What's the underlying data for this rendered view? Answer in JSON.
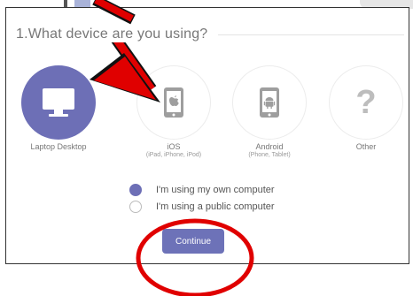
{
  "left_fragment": "e",
  "question": {
    "text": "1.What device are you using?"
  },
  "devices": [
    {
      "label": "Laptop Desktop",
      "sublabel": "",
      "icon": "monitor-icon",
      "selected": true
    },
    {
      "label": "iOS",
      "sublabel": "(iPad, iPhone, iPod)",
      "icon": "apple-phone-icon",
      "selected": false
    },
    {
      "label": "Android",
      "sublabel": "(Phone, Tablet)",
      "icon": "android-phone-icon",
      "selected": false
    },
    {
      "label": "Other",
      "sublabel": "",
      "icon": "question-mark-icon",
      "selected": false
    }
  ],
  "other_icon_glyph": "?",
  "computer_options": [
    {
      "label": "I'm using my own computer",
      "checked": true
    },
    {
      "label": "I'm using a public computer",
      "checked": false
    }
  ],
  "continue_button": {
    "label": "Continue"
  },
  "colors": {
    "accent": "#6d6fb6",
    "annotation_red": "#e00000"
  }
}
